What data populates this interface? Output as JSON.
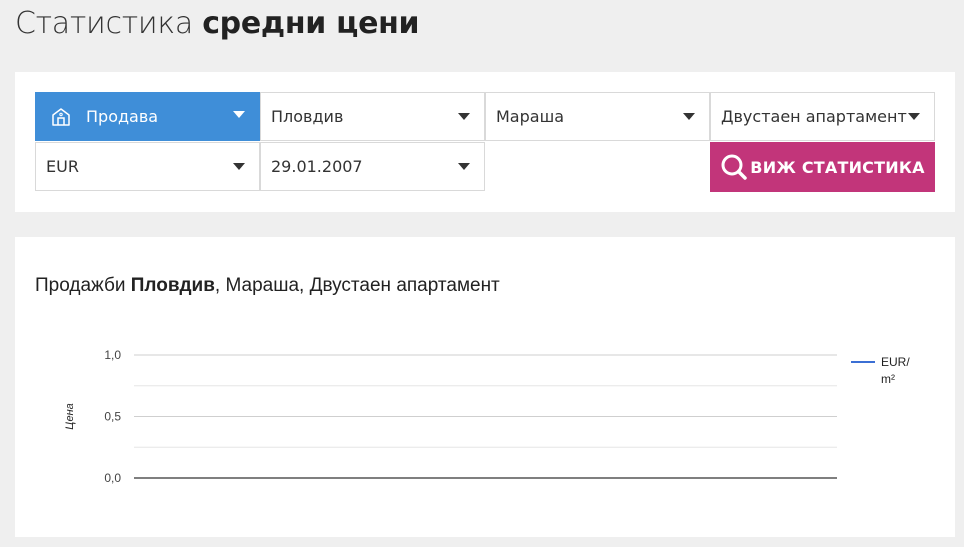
{
  "page": {
    "title_regular": "Статистика",
    "title_bold": "средни цени"
  },
  "filters": {
    "deal_type": "Продава",
    "city": "Пловдив",
    "district": "Мараша",
    "property_type": "Двустаен апартамент",
    "currency": "EUR",
    "date": "29.01.2007",
    "submit_label": "ВИЖ СТАТИСТИКА"
  },
  "chart_heading": {
    "prefix": "Продажби",
    "city": "Пловдив",
    "suffix": ", Мараша, Двустаен апартамент"
  },
  "colors": {
    "accent_blue": "#3f8ed8",
    "button_magenta": "#c2357a",
    "series_line": "#3b6fd4"
  },
  "chart_data": {
    "type": "line",
    "title": "",
    "xlabel": "",
    "ylabel": "Цена",
    "ylim": [
      0,
      1
    ],
    "yticks": [
      "1,0",
      "0,5",
      "0,0"
    ],
    "ytick_values": [
      1,
      0.5,
      0
    ],
    "grid": true,
    "legend_position": "right",
    "series": [
      {
        "name": "EUR/ m²",
        "legend_lines": [
          "EUR/",
          "m²"
        ],
        "values": []
      }
    ]
  }
}
